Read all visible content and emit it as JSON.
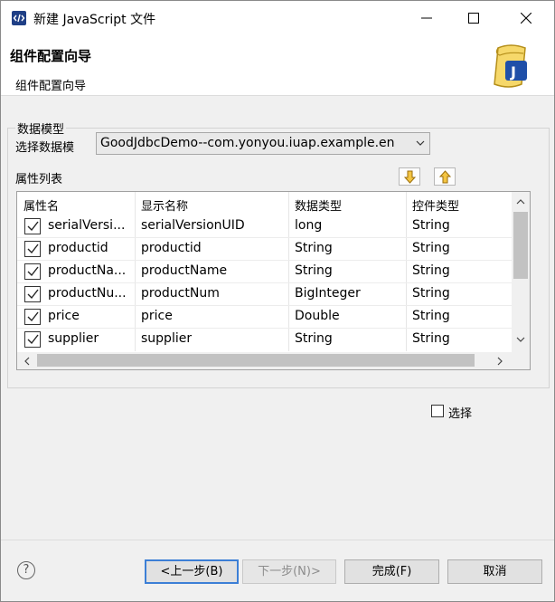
{
  "window": {
    "title": "新建 JavaScript 文件"
  },
  "banner": {
    "title": "组件配置向导",
    "subtitle": "组件配置向导"
  },
  "group": {
    "label": "数据模型",
    "select_label": "选择数据模",
    "select_value": "GoodJdbcDemo--com.yonyou.iuap.example.en",
    "list_label": "属性列表"
  },
  "table": {
    "headers": [
      "属性名",
      "显示名称",
      "数据类型",
      "控件类型"
    ],
    "rows": [
      {
        "checked": true,
        "name": "serialVersi...",
        "display": "serialVersionUID",
        "type": "long",
        "control": "String"
      },
      {
        "checked": true,
        "name": "productid",
        "display": "productid",
        "type": "String",
        "control": "String"
      },
      {
        "checked": true,
        "name": "productNa...",
        "display": "productName",
        "type": "String",
        "control": "String"
      },
      {
        "checked": true,
        "name": "productNu...",
        "display": "productNum",
        "type": "BigInteger",
        "control": "String"
      },
      {
        "checked": true,
        "name": "price",
        "display": "price",
        "type": "Double",
        "control": "String"
      },
      {
        "checked": true,
        "name": "supplier",
        "display": "supplier",
        "type": "String",
        "control": "String"
      }
    ]
  },
  "select_checkbox": {
    "label": "选择",
    "checked": false
  },
  "buttons": {
    "back": "<上一步(B)",
    "next": "下一步(N)>",
    "finish": "完成(F)",
    "cancel": "取消"
  },
  "colors": {
    "accent": "#3c7fd6",
    "icon_bg": "#1f3f86",
    "arrow_fill": "#f4c542"
  }
}
